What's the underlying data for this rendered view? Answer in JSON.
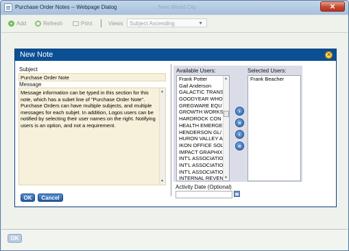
{
  "window": {
    "title": "Purchase Order Notes -- Webpage Dialog",
    "background_title": "New World City",
    "close_glyph": "✕"
  },
  "toolbar": {
    "add_label": "Add",
    "refresh_label": "Refresh",
    "print_label": "Print",
    "views_label": "Views",
    "views_value": "Subject Ascending"
  },
  "note": {
    "title": "New Note",
    "subject_label": "Subject",
    "subject_value": "Purchase Order Note",
    "message_label": "Message",
    "message_value": "Message information can be typed in this section for this note, which has a subet line of \"Purchase Order Note\". Purchase Orders can have multiple subjects, and multiple messages for each subjet.  In addition, Logos users can be notified by selecting their user names on the right. Notifying users is an option, and not a requirement.",
    "ok_label": "OK",
    "cancel_label": "Cancel",
    "available_users_label": "Available Users:",
    "selected_users_label": "Selected Users:",
    "available_users": [
      "Frank Potter",
      "Gail Anderson",
      "GALACTIC TRANS",
      "GOODYEAR WHO",
      "GREGWARE EQU",
      "GROWTH WORKS",
      "HARDROCK CON",
      "HEALTH EMERGE",
      "HENDERSON GL/",
      "HURON VALLEY A",
      "IKON OFFICE SOL",
      "IMPACT GRAPHIX",
      "INT'L ASSOCIATIO",
      "INT'L ASSOCIATIO",
      "INT'L ASSOCIATIO",
      "INTERNAL REVEN"
    ],
    "selected_users": [
      "Frank Beacher"
    ],
    "activity_date_label": "Activity Date (Optional)",
    "activity_date_value": ""
  },
  "footer": {
    "ok_label": "OK"
  },
  "colors": {
    "note_header": "#0b4f95",
    "subject_fill": "#f7f1db",
    "users_panel": "#dadde8"
  }
}
